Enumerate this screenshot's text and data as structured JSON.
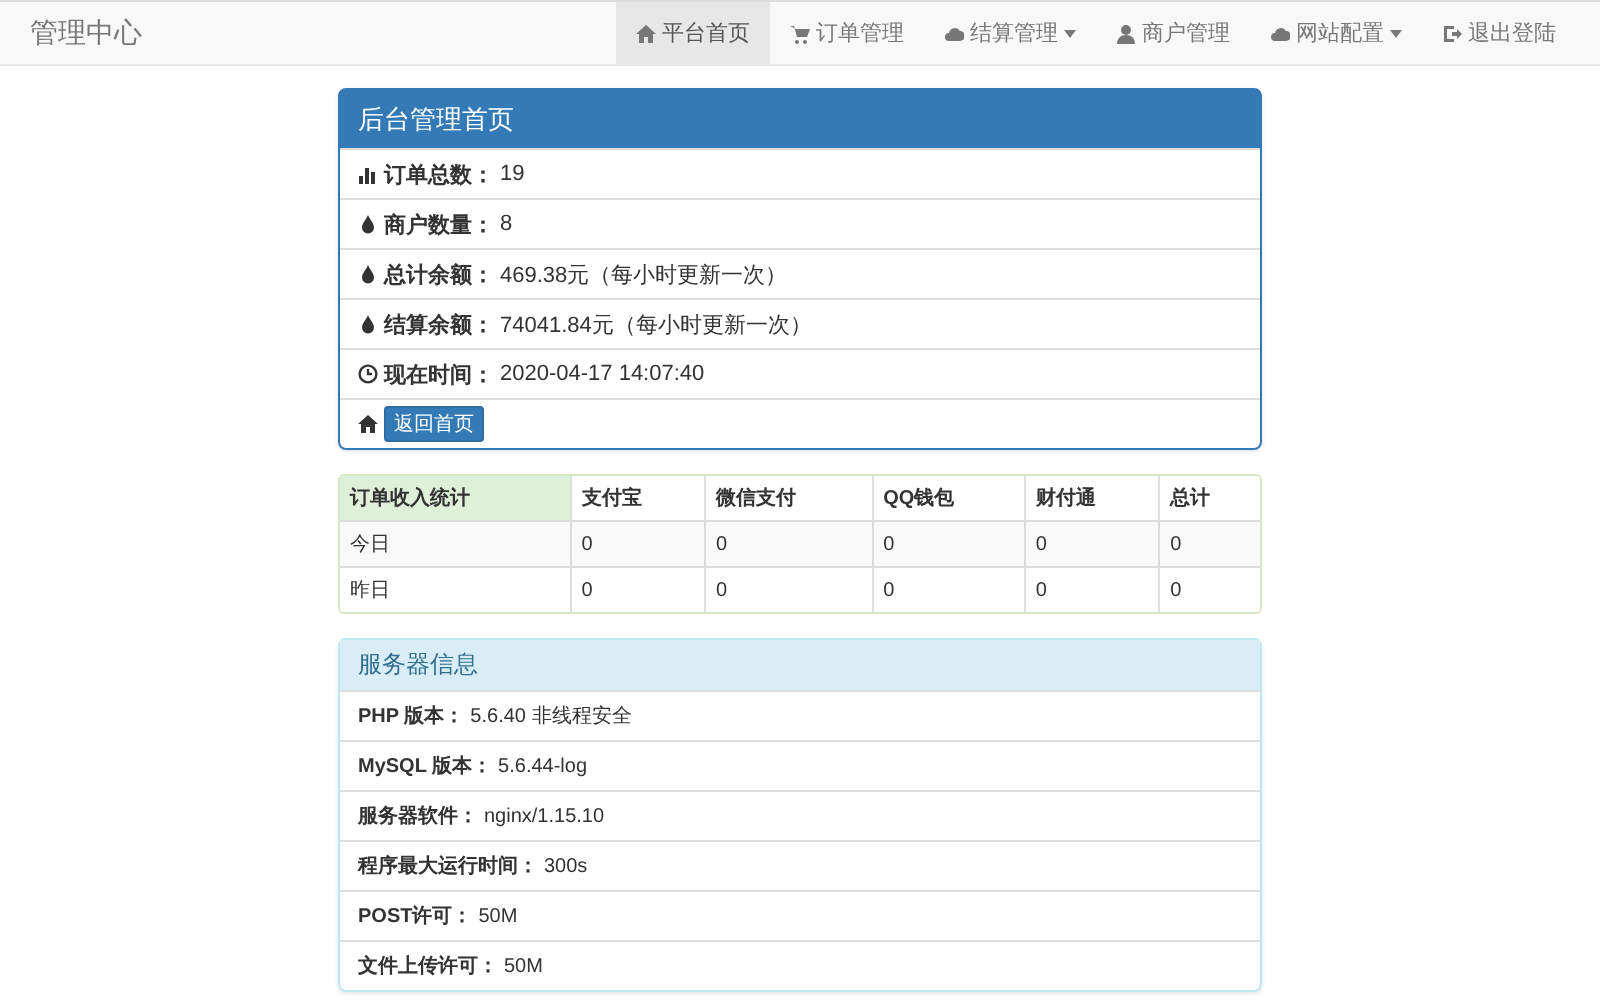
{
  "navbar": {
    "brand": "管理中心",
    "items": [
      {
        "label": "平台首页",
        "kind": "home",
        "dropdown": false,
        "selected": true
      },
      {
        "label": "订单管理",
        "kind": "cart",
        "dropdown": false,
        "selected": false
      },
      {
        "label": "结算管理",
        "kind": "cloud",
        "dropdown": true,
        "selected": false
      },
      {
        "label": "商户管理",
        "kind": "user",
        "dropdown": false,
        "selected": false
      },
      {
        "label": "网站配置",
        "kind": "cloud",
        "dropdown": true,
        "selected": false
      },
      {
        "label": "退出登陆",
        "kind": "logout",
        "dropdown": false,
        "selected": false
      }
    ]
  },
  "overview": {
    "title": "后台管理首页",
    "rows": [
      {
        "kind": "chart",
        "label": "订单总数：",
        "value": "19"
      },
      {
        "kind": "drop",
        "label": "商户数量：",
        "value": "8"
      },
      {
        "kind": "drop",
        "label": "总计余额：",
        "value": "469.38元（每小时更新一次）"
      },
      {
        "kind": "drop",
        "label": "结算余额：",
        "value": "74041.84元（每小时更新一次）"
      },
      {
        "kind": "clock",
        "label": "现在时间：",
        "value": " 2020-04-17 14:07:40"
      }
    ],
    "footer": {
      "kind": "home",
      "button": "返回首页"
    }
  },
  "income_table": {
    "columns": [
      "订单收入统计",
      "支付宝",
      "微信支付",
      "QQ钱包",
      "财付通",
      "总计"
    ],
    "rows": [
      [
        "今日",
        "0",
        "0",
        "0",
        "0",
        "0"
      ],
      [
        "昨日",
        "0",
        "0",
        "0",
        "0",
        "0"
      ]
    ]
  },
  "server_info": {
    "title": "服务器信息",
    "rows": [
      {
        "label": "PHP 版本：",
        "value": "5.6.40 非线程安全"
      },
      {
        "label": "MySQL 版本：",
        "value": "5.6.44-log"
      },
      {
        "label": "服务器软件：",
        "value": "nginx/1.15.10"
      },
      {
        "label": "程序最大运行时间：",
        "value": "300s"
      },
      {
        "label": "POST许可：",
        "value": "50M"
      },
      {
        "label": "文件上传许可：",
        "value": "50M"
      }
    ]
  }
}
